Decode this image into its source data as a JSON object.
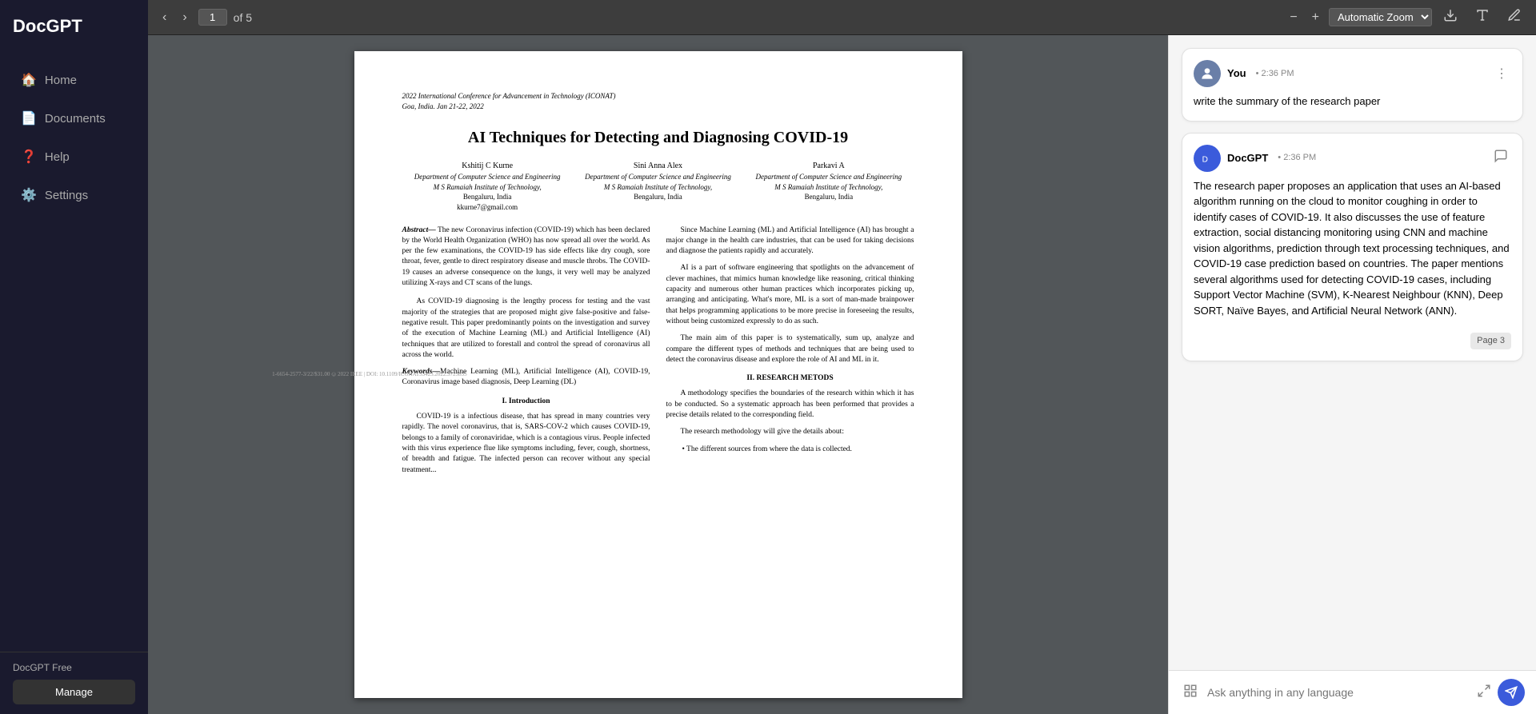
{
  "sidebar": {
    "logo": "DocGPT",
    "nav_items": [
      {
        "id": "home",
        "label": "Home",
        "icon": "🏠"
      },
      {
        "id": "documents",
        "label": "Documents",
        "icon": "📄"
      },
      {
        "id": "help",
        "label": "Help",
        "icon": "❓"
      },
      {
        "id": "settings",
        "label": "Settings",
        "icon": "⚙️"
      }
    ],
    "plan_label": "DocGPT Free",
    "manage_btn": "Manage"
  },
  "toolbar": {
    "prev_btn": "‹",
    "next_btn": "›",
    "page_current": "1",
    "page_total": "of 5",
    "zoom_out": "−",
    "zoom_in": "+",
    "zoom_label": "Automatic Zoom",
    "zoom_chevron": "▾",
    "download_icon": "⬇",
    "text_icon": "T",
    "pen_icon": "✎"
  },
  "pdf": {
    "conference": "2022 International Conference for Advancement in Technology (ICONAT)",
    "conference_location": "Goa, India. Jan 21-22, 2022",
    "title": "AI Techniques for Detecting and Diagnosing COVID-19",
    "authors": [
      {
        "name": "Kshitij C Kurne",
        "dept": "Department of Computer Science and Engineering",
        "institute": "M S Ramaiah Institute of Technology,",
        "location": "Bengaluru, India",
        "email": "kkurne7@gmail.com"
      },
      {
        "name": "Sini Anna Alex",
        "dept": "Department of Computer Science and Engineering",
        "institute": "M S Ramaiah Institute of Technology,",
        "location": "Bengaluru, India",
        "email": ""
      },
      {
        "name": "Parkavi A",
        "dept": "Department of Computer Science and Engineering",
        "institute": "M S Ramaiah Institute of Technology,",
        "location": "Bengaluru, India",
        "email": ""
      }
    ],
    "abstract_label": "Abstract",
    "abstract_text": "The new Coronavirus infection (COVID-19) which has been declared by the World Health Organization (WHO) has now spread all over the world. As per the few examinations, the COVID-19 has side effects like dry cough, sore throat, fever, gentle to direct respiratory disease and muscle throbs. The COVID-19 causes an adverse consequence on the lungs, it very well may be analyzed utilizing X-rays and CT scans of the lungs.",
    "abstract_para2": "As COVID-19 diagnosing is the lengthy process for testing and the vast majority of the strategies that are proposed might give false-positive and false-negative result. This paper predominantly points on the investigation and survey of the execution of Machine Learning (ML) and Artificial Intelligence (AI) techniques that are utilized to forestall and control the spread of coronavirus all across the world.",
    "keywords_label": "Keywords",
    "keywords_text": "Machine Learning (ML), Artificial Intelligence (AI), COVID-19, Coronavirus image based diagnosis, Deep Learning (DL)",
    "intro_heading": "I.   Introduction",
    "intro_text": "COVID-19 is a infectious disease, that has spread in many countries very rapidly. The novel coronavirus, that is, SARS-COV-2 which causes COVID-19, belongs to a family of coronaviridae, which is a contagious virus. People infected with this virus experience flue like symptoms including, fever, cough, shortness, of breadth and fatigue. The infected person can recover without any special treatment...",
    "right_col_para1": "Since Machine Learning (ML) and Artificial Intelligence (AI) has brought a major change in the health care industries, that can be used for taking decisions and diagnose the patients rapidly and accurately.",
    "right_col_para2": "AI is a part of software engineering that spotlights on the advancement of clever machines, that mimics human knowledge like reasoning, critical thinking capacity and numerous other human practices which incorporates picking up, arranging and anticipating. What's more, ML is a sort of man-made brainpower that helps programming applications to be more precise in foreseeing the results, without being customized expressly to do as such.",
    "right_col_para3": "The main aim of this paper is to systematically, sum up, analyze and compare the different types of methods and techniques that are being used to detect the coronavirus disease and explore the role of AI and ML in it.",
    "research_heading": "II.   RESEARCH METODS",
    "research_para": "A methodology specifies the boundaries of the research within which it has to be conducted. So a systematic approach has been performed that provides a precise details related to the corresponding field.",
    "research_para2": "The research methodology will give the details about:",
    "research_bullet": "The different sources from where the data is collected.",
    "watermark": "1-6654-2577-3/22/$31.00 ©2022 IEEE | DOI: 10.1109/ICONAT53423.2022.9725835"
  },
  "chat": {
    "messages": [
      {
        "id": "user-msg-1",
        "sender": "You",
        "time": "2:36 PM",
        "text": "write the summary of the research paper",
        "type": "user",
        "avatar_icon": "👤"
      },
      {
        "id": "bot-msg-1",
        "sender": "DocGPT",
        "time": "2:36 PM",
        "text": "The research paper proposes an application that uses an AI-based algorithm running on the cloud to monitor coughing in order to identify cases of COVID-19. It also discusses the use of feature extraction, social distancing monitoring using CNN and machine vision algorithms, prediction through text processing techniques, and COVID-19 case prediction based on countries. The paper mentions several algorithms used for detecting COVID-19 cases, including Support Vector Machine (SVM), K-Nearest Neighbour (KNN), Deep SORT, Naïve Bayes, and Artificial Neural Network (ANN).",
        "type": "bot",
        "page_badge": "Page 3",
        "avatar_icon": "📘"
      }
    ],
    "input_placeholder": "Ask anything in any language",
    "input_value": ""
  }
}
